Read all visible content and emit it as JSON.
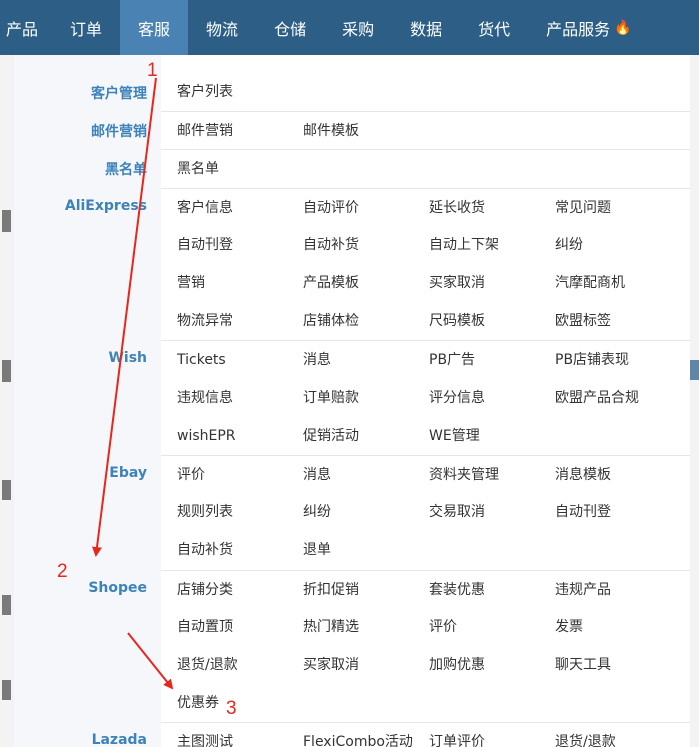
{
  "nav": {
    "items": [
      "产品",
      "订单",
      "客服",
      "物流",
      "仓储",
      "采购",
      "数据",
      "货代",
      "产品服务"
    ],
    "active_index": 2,
    "fire_icon": "fire-icon"
  },
  "colors": {
    "nav_bg": "#2d5f86",
    "nav_active": "#4a83b3",
    "category_text": "#3d82b8",
    "annotation": "#e8261b"
  },
  "categories": [
    {
      "label": "客户管理",
      "rows": [
        [
          "客户列表"
        ]
      ]
    },
    {
      "label": "邮件营销",
      "rows": [
        [
          "邮件营销",
          "邮件模板"
        ]
      ]
    },
    {
      "label": "黑名单",
      "rows": [
        [
          "黑名单"
        ]
      ]
    },
    {
      "label": "AliExpress",
      "rows": [
        [
          "客户信息",
          "自动评价",
          "延长收货",
          "常见问题"
        ],
        [
          "自动刊登",
          "自动补货",
          "自动上下架",
          "纠纷"
        ],
        [
          "营销",
          "产品模板",
          "买家取消",
          "汽摩配商机"
        ],
        [
          "物流异常",
          "店铺体检",
          "尺码模板",
          "欧盟标签"
        ]
      ]
    },
    {
      "label": "Wish",
      "rows": [
        [
          "Tickets",
          "消息",
          "PB广告",
          "PB店铺表现"
        ],
        [
          "违规信息",
          "订单赔款",
          "评分信息",
          "欧盟产品合规"
        ],
        [
          "wishEPR",
          "促销活动",
          "WE管理"
        ]
      ]
    },
    {
      "label": "Ebay",
      "rows": [
        [
          "评价",
          "消息",
          "资料夹管理",
          "消息模板"
        ],
        [
          "规则列表",
          "纠纷",
          "交易取消",
          "自动刊登"
        ],
        [
          "自动补货",
          "退单"
        ]
      ]
    },
    {
      "label": "Shopee",
      "rows": [
        [
          "店铺分类",
          "折扣促销",
          "套装优惠",
          "违规产品"
        ],
        [
          "自动置顶",
          "热门精选",
          "评价",
          "发票"
        ],
        [
          "退货/退款",
          "买家取消",
          "加购优惠",
          "聊天工具"
        ],
        [
          "优惠券"
        ]
      ]
    },
    {
      "label": "Lazada",
      "rows": [
        [
          "主图测试",
          "FlexiCombo活动",
          "订单评价",
          "退货/退款"
        ]
      ]
    }
  ],
  "annotations": [
    "1",
    "2",
    "3"
  ]
}
